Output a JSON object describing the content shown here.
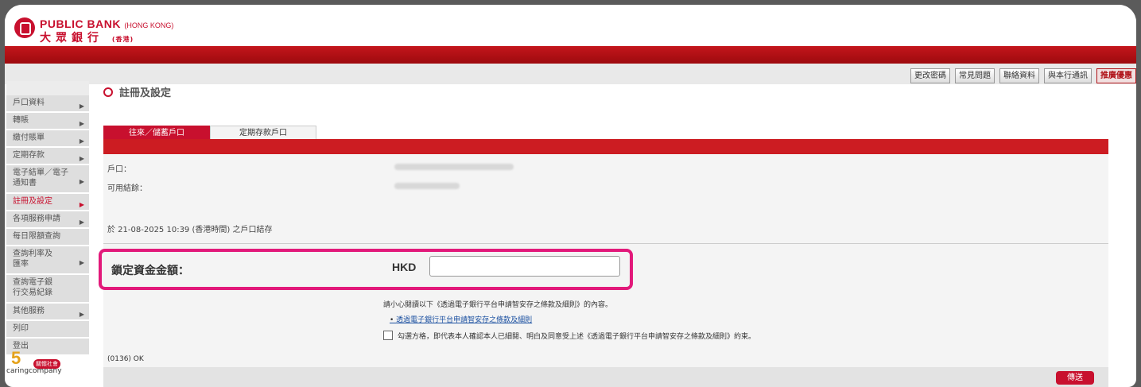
{
  "brand": {
    "name_en": "PUBLIC BANK",
    "name_en_suffix": "(HONG KONG)",
    "name_zh": "大眾銀行",
    "name_zh_suffix": "(香港)"
  },
  "topnav": [
    {
      "label": "更改密碼"
    },
    {
      "label": "常見問題"
    },
    {
      "label": "聯絡資料"
    },
    {
      "label": "與本行通訊"
    },
    {
      "label": "推廣優惠"
    }
  ],
  "sidebar": {
    "items": [
      {
        "label": "戶口資料",
        "arrow": "▶"
      },
      {
        "label": "轉賬",
        "arrow": "▶"
      },
      {
        "label": "繳付賬單",
        "arrow": "▶"
      },
      {
        "label": "定期存款",
        "arrow": "▶"
      },
      {
        "label": "電子結單／電子通知書",
        "arrow": "▶"
      },
      {
        "label": "註冊及設定",
        "arrow": "▶"
      },
      {
        "label": "各項服務申請",
        "arrow": "▶"
      },
      {
        "label": "每日限額查詢"
      },
      {
        "label": "查詢利率及匯率",
        "arrow": "▶"
      },
      {
        "label": "查詢電子銀行交易紀錄"
      },
      {
        "label": "其他服務",
        "arrow": "▶"
      },
      {
        "label": "列印"
      },
      {
        "label": "登出"
      }
    ],
    "logo_number": "5",
    "logo_badge": "關懷社會",
    "logo_text": "caringcompany"
  },
  "page": {
    "title": "註冊及設定"
  },
  "tabs": [
    {
      "label": "往來／儲蓄戶口"
    },
    {
      "label": "定期存款戶口"
    }
  ],
  "form": {
    "account_label": "戶口：",
    "available_label": "可用結餘：",
    "balance_date": "於 21-08-2025 10:39 (香港時間) 之戶口結存",
    "lock_label": "鎖定資金金額：",
    "currency": "HKD",
    "amount_value": "",
    "notice": "請小心閱讀以下《透過電子銀行平台申請智安存之條款及細則》的內容。",
    "terms_link": "透過電子銀行平台申請智安存之條款及細則",
    "consent": "勾選方格，即代表本人確認本人已細閱、明白及同意受上述《透過電子銀行平台申請智安存之條款及細則》約束。",
    "status": "(0136) OK",
    "submit_label": "傳送"
  },
  "colors": {
    "brand_red": "#c8102e",
    "highlight": "#e2197a"
  }
}
